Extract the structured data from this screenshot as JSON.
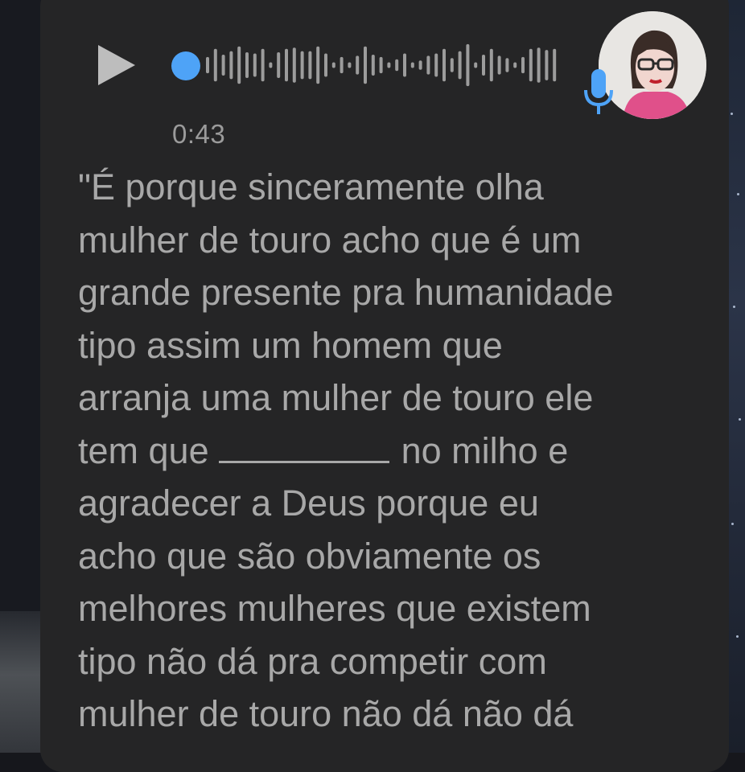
{
  "voice_message": {
    "duration": "0:43",
    "progress": 0.0,
    "play_icon": "play-icon",
    "mic_icon": "microphone-icon",
    "accent_color": "#4ea3f7",
    "waveform_heights": [
      0.35,
      0.7,
      0.45,
      0.6,
      0.8,
      0.55,
      0.5,
      0.7,
      0.12,
      0.55,
      0.7,
      0.75,
      0.6,
      0.6,
      0.8,
      0.5,
      0.12,
      0.35,
      0.12,
      0.4,
      0.8,
      0.45,
      0.35,
      0.12,
      0.25,
      0.5,
      0.12,
      0.2,
      0.4,
      0.5,
      0.7,
      0.3,
      0.6,
      0.9,
      0.12,
      0.45,
      0.7,
      0.4,
      0.3,
      0.12,
      0.35,
      0.7,
      0.75,
      0.65,
      0.7,
      0.7,
      0.7
    ]
  },
  "transcript": {
    "line1": "\"É porque sinceramente olha",
    "line2": "mulher de touro acho que é um",
    "line3": "grande presente pra humanidade",
    "line4": "tipo assim um homem que",
    "line5": "arranja uma mulher de touro ele",
    "line6_before": "tem que ",
    "line6_after": " no milho e",
    "line7": "agradecer a Deus porque eu",
    "line8": "acho que são obviamente os",
    "line9": "melhores mulheres que existem",
    "line10": "tipo não dá pra competir com",
    "line11": "mulher de touro não dá não dá"
  }
}
